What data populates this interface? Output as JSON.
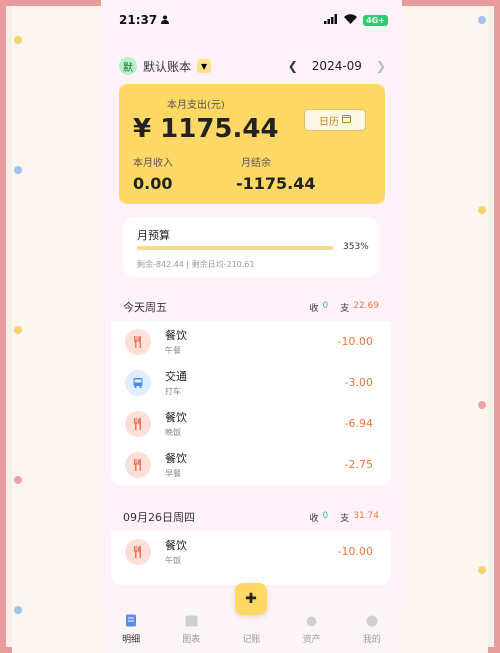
{
  "status": {
    "time": "21:37",
    "network": "4G+"
  },
  "header": {
    "book_avatar": "默",
    "book_name": "默认账本",
    "month": "2024-09"
  },
  "summary": {
    "title": "本月支出(元)",
    "amount": "¥ 1175.44",
    "calendar_label": "日历",
    "income_label": "本月收入",
    "income_value": "0.00",
    "balance_label": "月结余",
    "balance_value": "-1175.44"
  },
  "budget": {
    "title": "月预算",
    "percent": "353%",
    "fill_fraction": 1.0,
    "detail": "剩余-842.44 | 剩余日均-210.61"
  },
  "days": [
    {
      "title": "今天周五",
      "income_label": "收",
      "income": "0",
      "expense_label": "支",
      "expense": "22.69",
      "items": [
        {
          "icon": "utensils-icon",
          "category": "餐饮",
          "note": "午餐",
          "amount": "-10.00"
        },
        {
          "icon": "bus-icon",
          "category": "交通",
          "note": "打车",
          "amount": "-3.00"
        },
        {
          "icon": "utensils-icon",
          "category": "餐饮",
          "note": "晚饭",
          "amount": "-6.94"
        },
        {
          "icon": "utensils-icon",
          "category": "餐饮",
          "note": "早餐",
          "amount": "-2.75"
        }
      ]
    },
    {
      "title": "09月26日周四",
      "income_label": "收",
      "income": "0",
      "expense_label": "支",
      "expense": "31.74",
      "items": [
        {
          "icon": "utensils-icon",
          "category": "餐饮",
          "note": "午饭",
          "amount": "-10.00"
        }
      ]
    }
  ],
  "tabs": [
    {
      "label": "明细",
      "icon": "list-icon",
      "active": true
    },
    {
      "label": "图表",
      "icon": "chart-icon",
      "active": false
    },
    {
      "label": "记账",
      "icon": "plus-icon",
      "active": false
    },
    {
      "label": "资产",
      "icon": "wallet-icon",
      "active": false
    },
    {
      "label": "我的",
      "icon": "user-icon",
      "active": false
    }
  ],
  "colors": {
    "accent": "#ffd866",
    "income": "#2ecc71",
    "expense": "#f0773a"
  }
}
